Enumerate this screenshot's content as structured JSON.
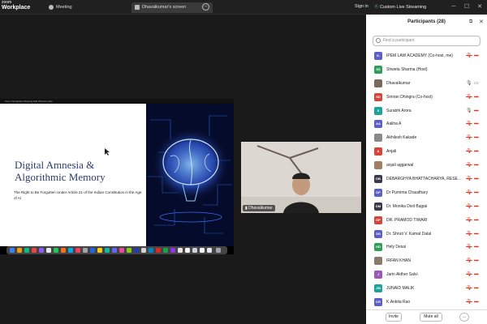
{
  "app": {
    "logo_line1": "zoom",
    "logo_line2": "Workplace"
  },
  "tabs": [
    {
      "label": "Meeting"
    },
    {
      "label": "Dhavalkumar's screen"
    }
  ],
  "header": {
    "sign_in": "Sign in",
    "stream_label": "Custom Live Streaming Service"
  },
  "shared_screen": {
    "menubar": "Zoom Workplace   Meeting   Edit   Window   Help",
    "slide_title": "Digital Amnesia & Algorithmic Memory",
    "slide_subtitle": "The Right to Be Forgotten Under Article 21 of the Indian Constitution in the Age of AI"
  },
  "video": {
    "name": "Dhavalkumar"
  },
  "participants_panel": {
    "title": "Participants (28)",
    "search_placeholder": "Find a participant",
    "items": [
      {
        "initials": "IL",
        "name": "IPEM LAW ACADEMY (Co-host, me)",
        "color": "#5b5fc7",
        "mic": "muted",
        "cam": "muted"
      },
      {
        "initials": "SS",
        "name": "Shweta Sharma (Host)",
        "color": "#2f9e5a",
        "mic": "none",
        "cam": "none"
      },
      {
        "initials": "",
        "name": "Dhavalkumar",
        "color": "#7a6a5a",
        "mic": "live",
        "cam": "live"
      },
      {
        "initials": "SD",
        "name": "Simran Dhingra (Co-host)",
        "color": "#d9443a",
        "mic": "muted",
        "cam": "muted"
      },
      {
        "initials": "S",
        "name": "Surabhi Arora",
        "color": "#1ba39c",
        "mic": "live",
        "cam": "muted"
      },
      {
        "initials": "AA",
        "name": "Aaliha A",
        "color": "#5b5fc7",
        "mic": "muted",
        "cam": "muted"
      },
      {
        "initials": "",
        "name": "Akhilesh Kakade",
        "color": "#8a8a8a",
        "mic": "muted",
        "cam": "muted"
      },
      {
        "initials": "A",
        "name": "Anjali",
        "color": "#d9443a",
        "mic": "muted",
        "cam": "muted"
      },
      {
        "initials": "",
        "name": "anjali aggarwal",
        "color": "#a08060",
        "mic": "muted",
        "cam": "muted"
      },
      {
        "initials": "DB",
        "name": "DEBARGHYA BHATTACHARYA, RESEARCH...",
        "color": "#3a3a4a",
        "mic": "muted",
        "cam": "muted"
      },
      {
        "initials": "DP",
        "name": "Dr Purnima Chaudhary",
        "color": "#5b5fc7",
        "mic": "muted",
        "cam": "muted"
      },
      {
        "initials": "DM",
        "name": "Dr. Monika Dixit Bajpai",
        "color": "#3a3a4a",
        "mic": "muted",
        "cam": "muted"
      },
      {
        "initials": "DP",
        "name": "DR. PRAMOD TIWARI",
        "color": "#d9443a",
        "mic": "muted",
        "cam": "muted"
      },
      {
        "initials": "DS",
        "name": "Dr. Shruti V. Kamat Dalal",
        "color": "#5b5fc7",
        "mic": "muted",
        "cam": "muted"
      },
      {
        "initials": "HD",
        "name": "Hely Desai",
        "color": "#2f9e5a",
        "mic": "muted",
        "cam": "muted"
      },
      {
        "initials": "",
        "name": "IRFAN KHAN",
        "color": "#8a7a6a",
        "mic": "muted",
        "cam": "muted"
      },
      {
        "initials": "J",
        "name": "Jarin Akther Salvi",
        "color": "#9b59b6",
        "mic": "muted",
        "cam": "muted"
      },
      {
        "initials": "JM",
        "name": "JUNAID MALIK",
        "color": "#1ba39c",
        "mic": "muted",
        "cam": "muted"
      },
      {
        "initials": "KR",
        "name": "K.Ankita Rao",
        "color": "#5b5fc7",
        "mic": "muted",
        "cam": "muted"
      }
    ],
    "invite_label": "Invite",
    "mute_all_label": "Mute all",
    "more_label": "..."
  }
}
